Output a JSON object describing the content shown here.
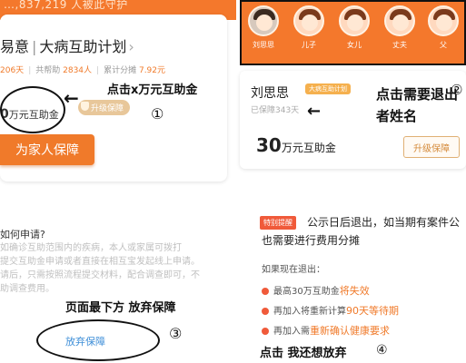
{
  "panel1": {
    "band_text": "…,837,219 人被此守护",
    "title_left": "易意",
    "title_right": "大病互助计划",
    "title_arrow": "›",
    "stats_a_num": "206天",
    "stats_b_label": "共帮助",
    "stats_b_num": "2834人",
    "stats_c_label": "累计分摊",
    "stats_c_num": "7.92元",
    "amount_num": "0",
    "amount_unit": "万元互助金",
    "upgrade_label": "升级保障",
    "annotation": "点击x万元互助金",
    "marker": "①",
    "cta_label": "为家人保障"
  },
  "panel2": {
    "members": [
      {
        "name": "刘思思",
        "style": "photo"
      },
      {
        "name": "儿子",
        "style": "cartoon"
      },
      {
        "name": "女儿",
        "style": "cartoon"
      },
      {
        "name": "丈夫",
        "style": "cartoon"
      },
      {
        "name": "父",
        "style": "cartoon"
      }
    ],
    "member_name": "刘思思",
    "badge": "大病互助计划",
    "protected_text": "已保障343天",
    "annotation": "点击需要退出者姓名",
    "marker": "②",
    "amount_num": "30",
    "amount_unit": "万元互助金",
    "upgrade_label": "升级保障"
  },
  "panel3": {
    "question": "如何申请?",
    "body_lines": [
      "如确诊互助范围内的疾病，本人或家属可拨打",
      "提交互助金申请或者直接在相互宝发起线上申请。",
      "请后，只需按照流程提交材料，配合调查即可，不",
      "助调查费用。"
    ],
    "annotation": "页面最下方 放弃保障",
    "marker": "③",
    "giveup_label": "放弃保障"
  },
  "panel4": {
    "tag": "特别提醒",
    "text1": "公示日后退出，如当期有案件公",
    "text2": "也需要进行费用分摊",
    "if_exit": "如果现在退出：",
    "items": [
      {
        "prefix": "最高30万互助金",
        "highlight": "将失效"
      },
      {
        "prefix": "再加入将重新计算",
        "highlight": "90天等待期"
      },
      {
        "prefix": "再加入需",
        "highlight": "重新确认健康要求"
      }
    ],
    "annotation": "点击 我还想放弃",
    "marker": "④"
  },
  "colors": {
    "brand_orange": "#f4782c",
    "link_blue": "#3f8fd8",
    "alert_red": "#f05a3a",
    "gold": "#e8c79a"
  }
}
